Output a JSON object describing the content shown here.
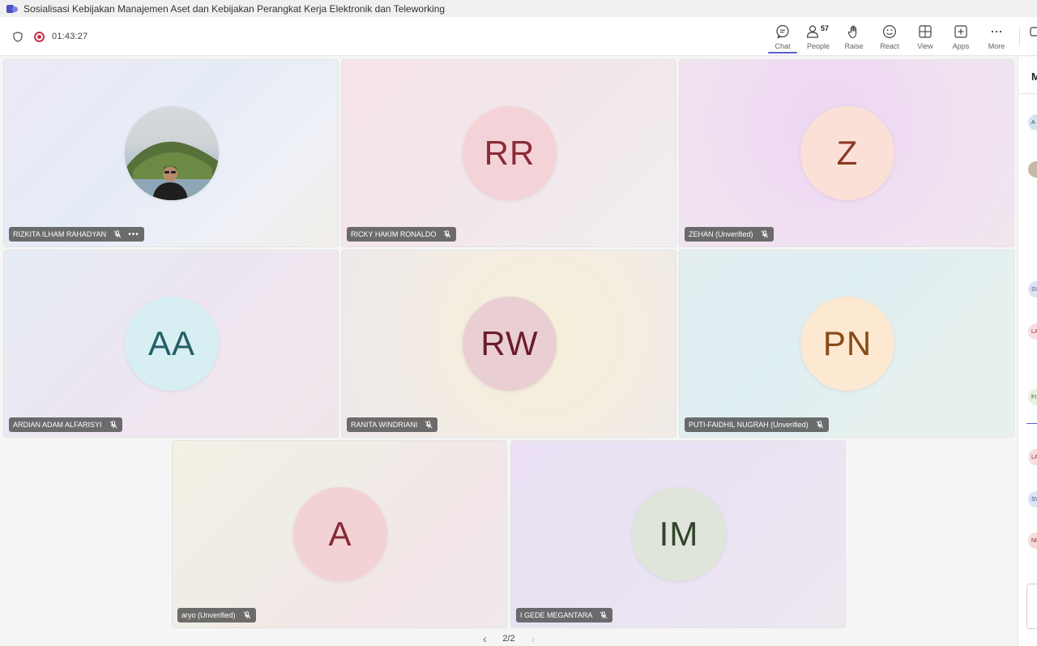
{
  "window": {
    "title": "Sosialisasi Kebijakan Manajemen Aset dan Kebijakan Perangkat Kerja Elektronik dan Teleworking"
  },
  "meeting": {
    "timer": "01:43:27"
  },
  "toolbar": {
    "chat_label": "Chat",
    "people_label": "People",
    "people_count": "57",
    "raise_label": "Raise",
    "react_label": "React",
    "view_label": "View",
    "apps_label": "Apps",
    "more_label": "More"
  },
  "participants": [
    {
      "name": "RIZKITA ILHAM RAHADYAN",
      "initials": "",
      "has_photo": true,
      "avatar_bg": "#cfd8dc",
      "initials_color": "#37474f"
    },
    {
      "name": "RICKY HAKIM RONALDO",
      "initials": "RR",
      "avatar_bg": "#f3d3d7",
      "initials_color": "#8a2b36"
    },
    {
      "name": "ZEHAN (Unverified)",
      "initials": "Z",
      "avatar_bg": "#fbe0d8",
      "initials_color": "#8a3a26"
    },
    {
      "name": "ARDIAN ADAM ALFARISYI",
      "initials": "AA",
      "avatar_bg": "#d7eef2",
      "initials_color": "#235f66"
    },
    {
      "name": "RANITA WINDRIANI",
      "initials": "RW",
      "avatar_bg": "#e9cfd3",
      "initials_color": "#6a1d29"
    },
    {
      "name": "PUTI-FAIDHIL NUGRAH (Unverified)",
      "initials": "PN",
      "avatar_bg": "#fde8d2",
      "initials_color": "#8a4b17"
    },
    {
      "name": "aryo (Unverified)",
      "initials": "A",
      "avatar_bg": "#f3d2d6",
      "initials_color": "#862a35"
    },
    {
      "name": "I GEDE MEGANTARA",
      "initials": "IM",
      "avatar_bg": "#dfe5da",
      "initials_color": "#31432a"
    }
  ],
  "pager": {
    "label": "2/2"
  },
  "side_panel": {
    "header": "M",
    "avatars": [
      "A",
      "",
      "SV",
      "LA",
      "FI",
      "LA",
      "SV",
      "NI"
    ]
  }
}
